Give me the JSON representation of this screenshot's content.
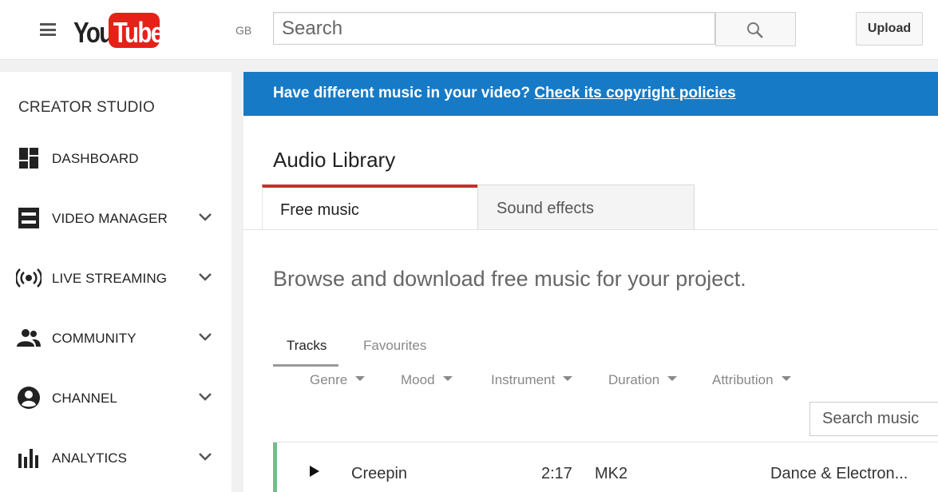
{
  "header": {
    "logo_you": "You",
    "logo_tube": "Tube",
    "region": "GB",
    "search_placeholder": "Search",
    "upload_label": "Upload"
  },
  "sidebar": {
    "title": "CREATOR STUDIO",
    "items": [
      {
        "label": "DASHBOARD",
        "icon": "dashboard-icon",
        "expandable": false
      },
      {
        "label": "VIDEO MANAGER",
        "icon": "video-manager-icon",
        "expandable": true
      },
      {
        "label": "LIVE STREAMING",
        "icon": "live-streaming-icon",
        "expandable": true
      },
      {
        "label": "COMMUNITY",
        "icon": "community-icon",
        "expandable": true
      },
      {
        "label": "CHANNEL",
        "icon": "channel-icon",
        "expandable": true
      },
      {
        "label": "ANALYTICS",
        "icon": "analytics-icon",
        "expandable": true
      }
    ]
  },
  "banner": {
    "text": "Have different music in your video?",
    "link": "Check its copyright policies"
  },
  "main": {
    "title": "Audio Library",
    "tabs": [
      {
        "label": "Free music",
        "active": true
      },
      {
        "label": "Sound effects",
        "active": false
      }
    ],
    "subtitle": "Browse and download free music for your project.",
    "subtabs": [
      {
        "label": "Tracks",
        "active": true
      },
      {
        "label": "Favourites",
        "active": false
      }
    ],
    "filters": [
      "Genre",
      "Mood",
      "Instrument",
      "Duration",
      "Attribution"
    ],
    "search_music_placeholder": "Search music",
    "tracks": [
      {
        "title": "Creepin",
        "duration": "2:17",
        "artist": "MK2",
        "genre": "Dance & Electron..."
      }
    ]
  },
  "colors": {
    "brand_red": "#e62117",
    "banner_blue": "#167ac6",
    "active_tab_accent": "#c4302b",
    "track_accent": "#6cc18a"
  }
}
